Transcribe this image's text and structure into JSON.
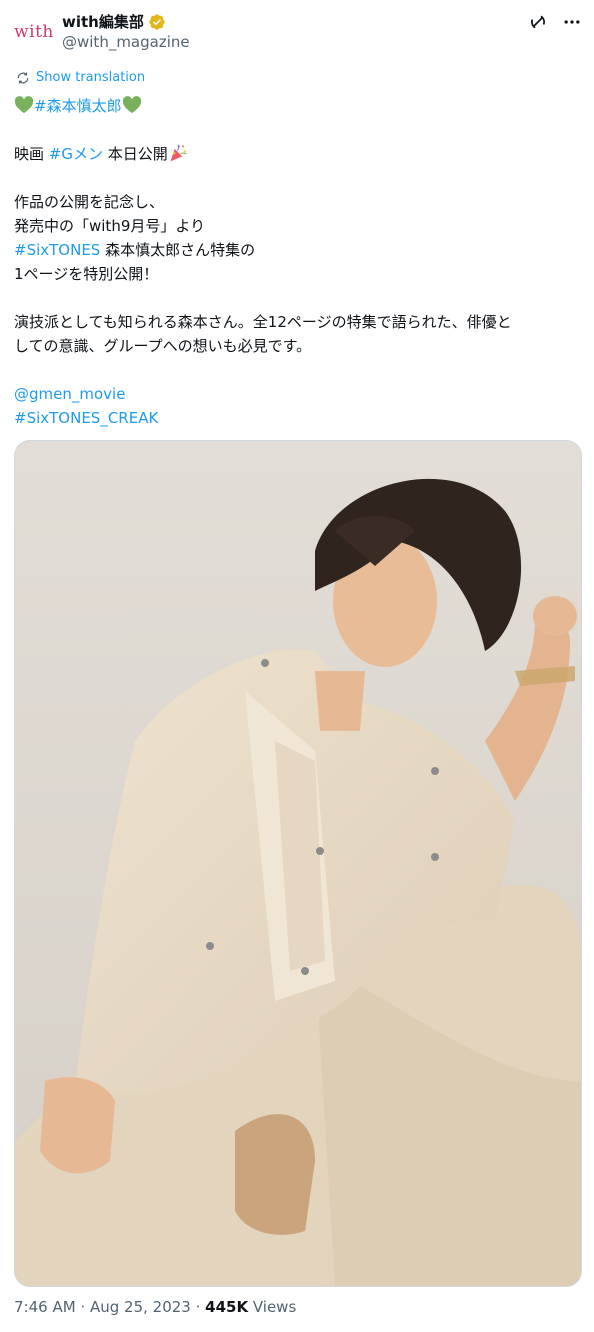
{
  "author": {
    "avatar_text": "with",
    "display_name": "with編集部",
    "handle": "@with_magazine"
  },
  "translate_label": "Show translation",
  "tweet": {
    "line1_tag": "#森本慎太郎",
    "line2_prefix": "映画 ",
    "line2_tag": "#Gメン",
    "line2_suffix": " 本日公開",
    "line3": "作品の公開を記念し、",
    "line4": "発売中の「with9月号」より",
    "line5_tag": "#SixTONES",
    "line5_suffix": " 森本慎太郎さん特集の",
    "line6": "1ページを特別公開！",
    "line7": "演技派としても知られる森本さん。全12ページの特集で語られた、俳優と",
    "line8": "しての意識、グループへの想いも必見です。",
    "mention": "@gmen_movie",
    "tag_last": "#SixTONES_CREAK"
  },
  "meta": {
    "time": "7:46 AM",
    "sep1": " · ",
    "date": "Aug 25, 2023",
    "sep2": " · ",
    "views_count": "445K",
    "views_label": " Views"
  },
  "icons": {
    "verified": "verified-badge-icon",
    "grok": "grok-icon",
    "more": "more-options-icon",
    "translate": "translate-icon",
    "heart": "green-heart-icon",
    "popper": "party-popper-icon"
  },
  "colors": {
    "link": "#1d9bf0",
    "text": "#0f1419",
    "secondary": "#536471",
    "verified": "#e2b719",
    "heart": "#78b159"
  }
}
